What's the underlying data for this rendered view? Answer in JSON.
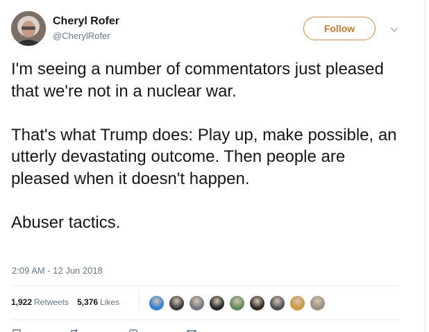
{
  "user": {
    "display_name": "Cheryl Rofer",
    "handle": "@CherylRofer"
  },
  "follow_label": "Follow",
  "tweet": {
    "paragraphs": [
      "I'm seeing a number of commentators just pleased that we're not in a nuclear war.",
      "That's what Trump does: Play up, make possible, an utterly devastating outcome. Then people are pleased when it doesn't happen.",
      "Abuser tactics."
    ],
    "timestamp": "2:09 AM - 12 Jun 2018"
  },
  "stats": {
    "retweets_count": "1,922",
    "retweets_label": "Retweets",
    "likes_count": "5,376",
    "likes_label": "Likes"
  },
  "liker_avatars": [
    {
      "icon": "avatar-icon",
      "color": "#2f7fd6"
    },
    {
      "icon": "avatar-icon",
      "color": "#3a3a3a"
    },
    {
      "icon": "avatar-icon",
      "color": "#6f7780"
    },
    {
      "icon": "avatar-icon",
      "color": "#262626"
    },
    {
      "icon": "avatar-icon",
      "color": "#5e8a57"
    },
    {
      "icon": "avatar-icon",
      "color": "#2d2a26"
    },
    {
      "icon": "avatar-icon",
      "color": "#4a4f57"
    },
    {
      "icon": "avatar-icon",
      "color": "#c9973d"
    },
    {
      "icon": "avatar-icon",
      "color": "#9a8f80"
    }
  ],
  "colors": {
    "follow_accent": "#c37b33",
    "secondary_text": "#657786",
    "divider": "#e6ecf0"
  }
}
